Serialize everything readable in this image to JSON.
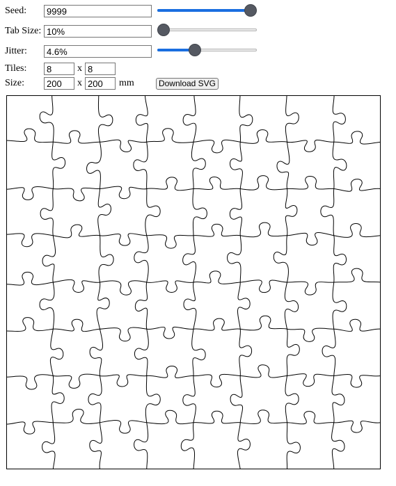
{
  "controls": {
    "seed": {
      "label": "Seed:",
      "value": "9999",
      "slider_fraction": 1.0
    },
    "tab_size": {
      "label": "Tab Size:",
      "value": "10%",
      "slider_fraction": 0.0
    },
    "jitter": {
      "label": "Jitter:",
      "value": "4.6%",
      "slider_fraction": 0.36
    },
    "tiles": {
      "label": "Tiles:",
      "x": "8",
      "y": "8",
      "separator": "x"
    },
    "size": {
      "label": "Size:",
      "width": "200",
      "height": "200",
      "separator": "x",
      "unit": "mm"
    },
    "download_label": "Download SVG"
  },
  "colors": {
    "slider_accent": "#1a6ee0",
    "slider_thumb": "#555962",
    "puzzle_stroke": "#000000"
  }
}
